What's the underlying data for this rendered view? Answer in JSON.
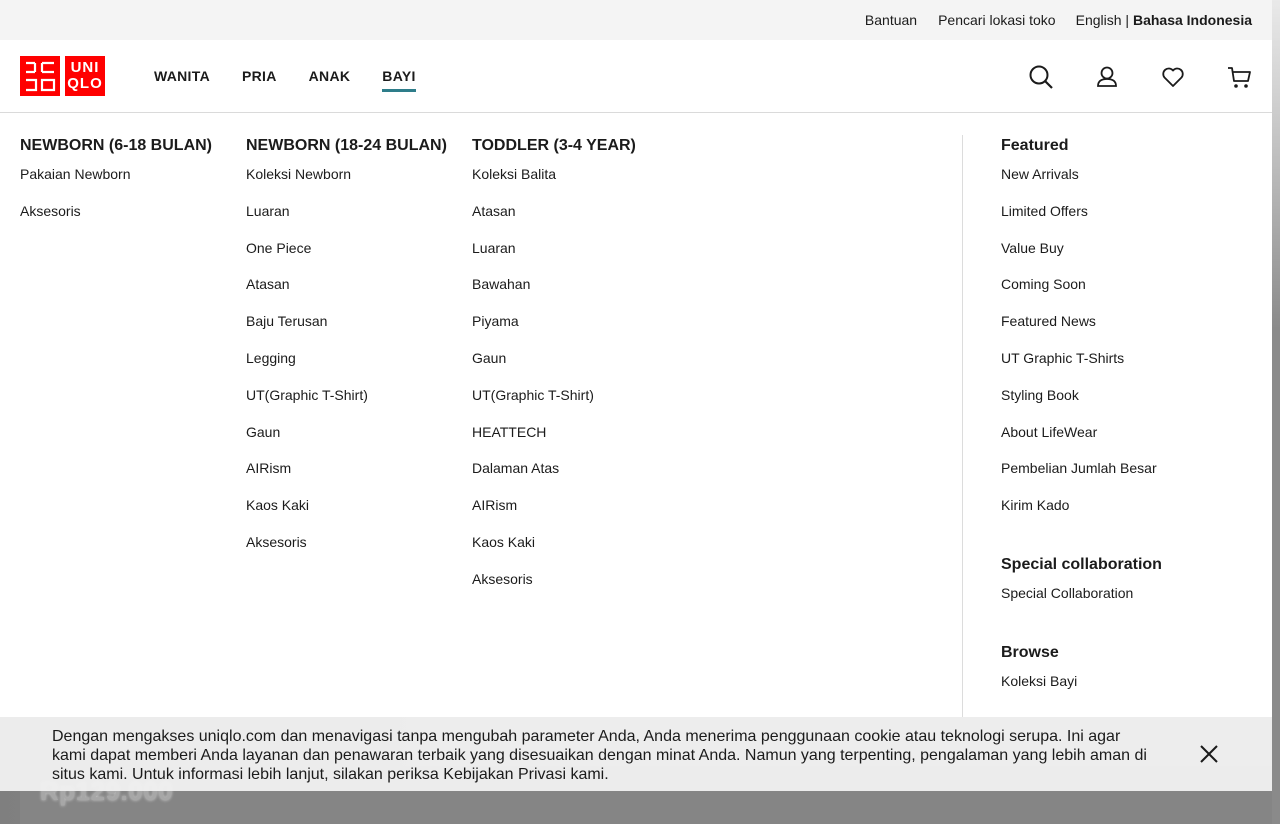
{
  "utility": {
    "help": "Bantuan",
    "store_locator": "Pencari lokasi toko",
    "lang_en": "English",
    "lang_sep": " | ",
    "lang_id": "Bahasa Indonesia"
  },
  "logo": {
    "line1a": "ユニ",
    "line1b": "UNI",
    "line2a": "クロ",
    "line2b": "QLO"
  },
  "nav": [
    "WANITA",
    "PRIA",
    "ANAK",
    "BAYI"
  ],
  "nav_active": "BAYI",
  "icons": [
    "search-icon",
    "account-icon",
    "wishlist-icon",
    "cart-icon"
  ],
  "columns": [
    {
      "title": "NEWBORN (6-18 BULAN)",
      "items": [
        "Pakaian Newborn",
        "Aksesoris"
      ]
    },
    {
      "title": "NEWBORN (18-24 BULAN)",
      "items": [
        "Koleksi Newborn",
        "Luaran",
        "One Piece",
        "Atasan",
        "Baju Terusan",
        "Legging",
        "UT(Graphic T-Shirt)",
        "Gaun",
        "AIRism",
        "Kaos Kaki",
        "Aksesoris"
      ]
    },
    {
      "title": "TODDLER (3-4 YEAR)",
      "items": [
        "Koleksi Balita",
        "Atasan",
        "Luaran",
        "Bawahan",
        "Piyama",
        "Gaun",
        "UT(Graphic T-Shirt)",
        "HEATTECH",
        "Dalaman Atas",
        "AIRism",
        "Kaos Kaki",
        "Aksesoris"
      ]
    }
  ],
  "side": {
    "featured_title": "Featured",
    "featured_items": [
      "New Arrivals",
      "Limited Offers",
      "Value Buy",
      "Coming Soon",
      "Featured News",
      "UT Graphic T-Shirts",
      "Styling Book",
      "About LifeWear",
      "Pembelian Jumlah Besar",
      "Kirim Kado"
    ],
    "collab_title": "Special collaboration",
    "collab_items": [
      "Special Collaboration"
    ],
    "browse_title": "Browse",
    "browse_items": [
      "Koleksi Bayi"
    ]
  },
  "cookie": {
    "text": "Dengan mengakses uniqlo.com dan menavigasi tanpa mengubah parameter Anda, Anda menerima penggunaan cookie atau teknologi serupa. Ini agar kami dapat memberi Anda layanan dan penawaran terbaik yang disesuaikan dengan minat Anda. Namun yang terpenting, pengalaman yang lebih aman di situs kami. Untuk informasi lebih lanjut, silakan periksa Kebijakan Privasi kami."
  },
  "background": {
    "price": "Rp129.000"
  }
}
